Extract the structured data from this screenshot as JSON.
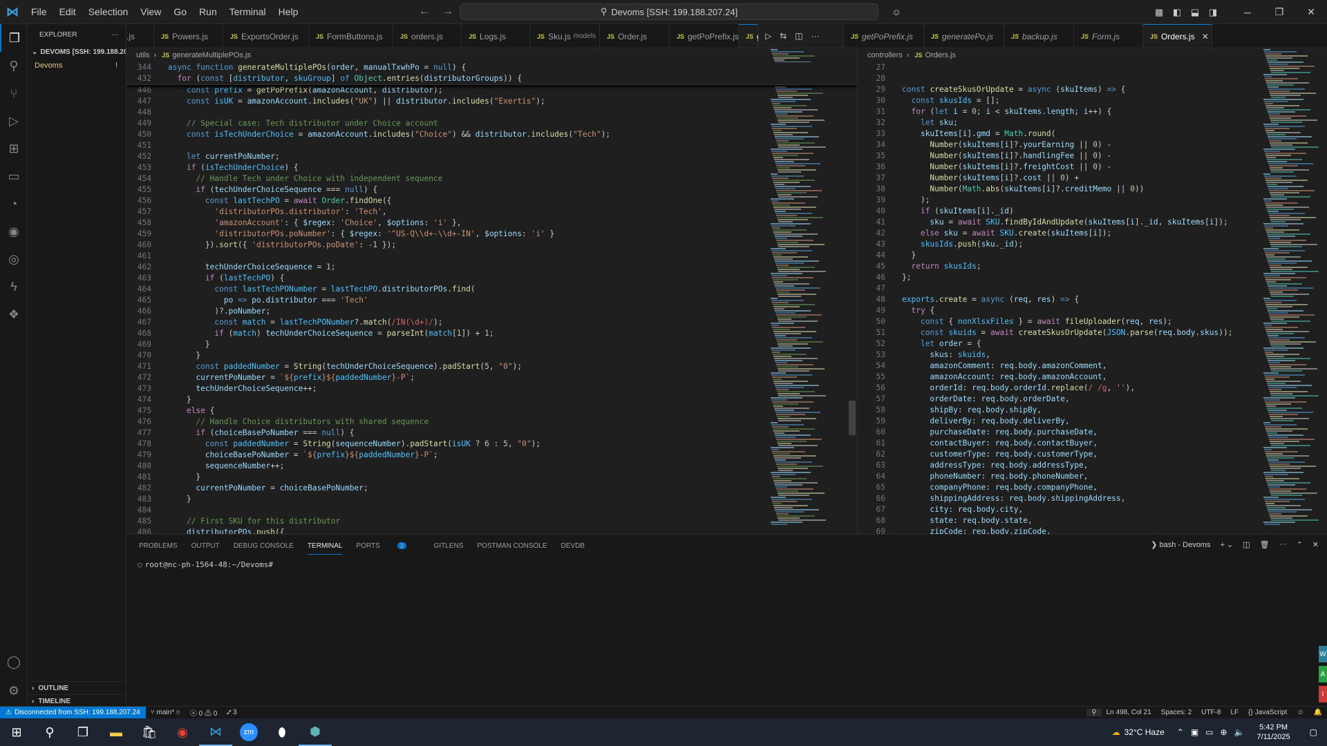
{
  "titlebar": {
    "menu": [
      "File",
      "Edit",
      "Selection",
      "View",
      "Go",
      "Run",
      "Terminal",
      "Help"
    ],
    "search_text": "Devoms [SSH: 199.188.207.24]"
  },
  "explorer": {
    "header": "EXPLORER",
    "root": "DEVOMS [SSH: 199.188.20...",
    "item": "Devoms",
    "item_badge": "!",
    "outline": "OUTLINE",
    "timeline": "TIMELINE"
  },
  "tabs": [
    {
      "label": ".js",
      "desc": ""
    },
    {
      "label": "Powers.js",
      "desc": ""
    },
    {
      "label": "ExportsOrder.js",
      "desc": ""
    },
    {
      "label": "FormButtons.js",
      "desc": ""
    },
    {
      "label": "orders.js",
      "desc": ""
    },
    {
      "label": "Logs.js",
      "desc": ""
    },
    {
      "label": "Sku.js",
      "desc": "models"
    },
    {
      "label": "Order.js",
      "desc": ""
    },
    {
      "label": "getPoPrefix.js",
      "desc": ""
    },
    {
      "label": "ge",
      "desc": ""
    }
  ],
  "tabs_right": [
    {
      "label": "getPoPrefix.js"
    },
    {
      "label": "generatePo.js"
    },
    {
      "label": "backup.js"
    },
    {
      "label": "Form.js"
    },
    {
      "label": "Orders.js"
    }
  ],
  "left_editor": {
    "breadcrumb": [
      "utils",
      "generateMultiplePOs.js"
    ],
    "sticky": [
      {
        "n": "344",
        "h": "<span class='k'>async</span> <span class='k'>function</span> <span class='f'>generateMultiplePOs</span>(<span class='v'>order</span>, <span class='v'>manualTxwhPo</span> = <span class='k'>null</span>) {"
      },
      {
        "n": "432",
        "h": "  <span class='c'>for</span> (<span class='k'>const</span> [<span class='cn'>distributor</span>, <span class='cn'>skuGroup</span>] <span class='k'>of</span> <span class='t'>Object</span>.<span class='f'>entries</span>(<span class='v'>distributorGroups</span>)) {"
      }
    ],
    "lines": [
      {
        "n": "446",
        "h": "    <span class='k'>const</span> <span class='cn'>prefix</span> = <span class='f'>getPoPrefix</span>(<span class='v'>amazonAccount</span>, <span class='v'>distributor</span>);"
      },
      {
        "n": "447",
        "h": "    <span class='k'>const</span> <span class='cn'>isUK</span> = <span class='v'>amazonAccount</span>.<span class='f'>includes</span>(<span class='s'>\"UK\"</span>) || <span class='v'>distributor</span>.<span class='f'>includes</span>(<span class='s'>\"Exertis\"</span>);"
      },
      {
        "n": "448",
        "h": ""
      },
      {
        "n": "449",
        "h": "    <span class='cm'>// Special case: Tech distributor under Choice account</span>"
      },
      {
        "n": "450",
        "h": "    <span class='k'>const</span> <span class='cn'>isTechUnderChoice</span> = <span class='v'>amazonAccount</span>.<span class='f'>includes</span>(<span class='s'>\"Choice\"</span>) &amp;&amp; <span class='v'>distributor</span>.<span class='f'>includes</span>(<span class='s'>\"Tech\"</span>);"
      },
      {
        "n": "451",
        "h": ""
      },
      {
        "n": "452",
        "h": "    <span class='k'>let</span> <span class='v'>currentPoNumber</span>;"
      },
      {
        "n": "453",
        "h": "    <span class='c'>if</span> (<span class='cn'>isTechUnderChoice</span>) {"
      },
      {
        "n": "454",
        "h": "      <span class='cm'>// Handle Tech under Choice with independent sequence</span>"
      },
      {
        "n": "455",
        "h": "      <span class='c'>if</span> (<span class='v'>techUnderChoiceSequence</span> === <span class='k'>null</span>) {"
      },
      {
        "n": "456",
        "h": "        <span class='k'>const</span> <span class='cn'>lastTechPO</span> = <span class='c'>await</span> <span class='t'>Order</span>.<span class='f'>findOne</span>({"
      },
      {
        "n": "457",
        "h": "          <span class='s'>'distributorPOs.distributor'</span>: <span class='s'>'Tech'</span>,"
      },
      {
        "n": "458",
        "h": "          <span class='s'>'amazonAccount'</span>: { <span class='v'>$regex</span>: <span class='s'>'Choice'</span>, <span class='v'>$options</span>: <span class='s'>'i'</span> },"
      },
      {
        "n": "459",
        "h": "          <span class='s'>'distributorPOs.poNumber'</span>: { <span class='v'>$regex</span>: <span class='s'>'^US-Q\\\\d+-\\\\d+-IN'</span>, <span class='v'>$options</span>: <span class='s'>'i'</span> }"
      },
      {
        "n": "460",
        "h": "        }).<span class='f'>sort</span>({ <span class='s'>'distributorPOs.poDate'</span>: <span class='n'>-1</span> });"
      },
      {
        "n": "461",
        "h": ""
      },
      {
        "n": "462",
        "h": "        <span class='v'>techUnderChoiceSequence</span> = <span class='n'>1</span>;"
      },
      {
        "n": "463",
        "h": "        <span class='c'>if</span> (<span class='cn'>lastTechPO</span>) {"
      },
      {
        "n": "464",
        "h": "          <span class='k'>const</span> <span class='cn'>lastTechPONumber</span> = <span class='cn'>lastTechPO</span>.<span class='v'>distributorPOs</span>.<span class='f'>find</span>("
      },
      {
        "n": "465",
        "h": "            <span class='v'>po</span> <span class='k'>=&gt;</span> <span class='v'>po</span>.<span class='v'>distributor</span> === <span class='s'>'Tech'</span>"
      },
      {
        "n": "466",
        "h": "          )?.<span class='v'>poNumber</span>;"
      },
      {
        "n": "467",
        "h": "          <span class='k'>const</span> <span class='cn'>match</span> = <span class='cn'>lastTechPONumber</span>?.<span class='f'>match</span>(<span class='r'>/IN(\\d+)/</span>);"
      },
      {
        "n": "468",
        "h": "          <span class='c'>if</span> (<span class='cn'>match</span>) <span class='v'>techUnderChoiceSequence</span> = <span class='f'>parseInt</span>(<span class='cn'>match</span>[<span class='n'>1</span>]) + <span class='n'>1</span>;"
      },
      {
        "n": "469",
        "h": "        }"
      },
      {
        "n": "470",
        "h": "      }"
      },
      {
        "n": "471",
        "h": "      <span class='k'>const</span> <span class='cn'>paddedNumber</span> = <span class='f'>String</span>(<span class='v'>techUnderChoiceSequence</span>).<span class='f'>padStart</span>(<span class='n'>5</span>, <span class='s'>\"0\"</span>);"
      },
      {
        "n": "472",
        "h": "      <span class='v'>currentPoNumber</span> = <span class='s'>`${</span><span class='cn'>prefix</span><span class='s'>}${</span><span class='cn'>paddedNumber</span><span class='s'>}-P`</span>;"
      },
      {
        "n": "473",
        "h": "      <span class='v'>techUnderChoiceSequence</span>++;"
      },
      {
        "n": "474",
        "h": "    }"
      },
      {
        "n": "475",
        "h": "    <span class='c'>else</span> {"
      },
      {
        "n": "476",
        "h": "      <span class='cm'>// Handle Choice distributors with shared sequence</span>"
      },
      {
        "n": "477",
        "h": "      <span class='c'>if</span> (<span class='v'>choiceBasePoNumber</span> === <span class='k'>null</span>) {"
      },
      {
        "n": "478",
        "h": "        <span class='k'>const</span> <span class='cn'>paddedNumber</span> = <span class='f'>String</span>(<span class='v'>sequenceNumber</span>).<span class='f'>padStart</span>(<span class='cn'>isUK</span> ? <span class='n'>6</span> : <span class='n'>5</span>, <span class='s'>\"0\"</span>);"
      },
      {
        "n": "479",
        "h": "        <span class='v'>choiceBasePoNumber</span> = <span class='s'>`${</span><span class='cn'>prefix</span><span class='s'>}${</span><span class='cn'>paddedNumber</span><span class='s'>}-P`</span>;"
      },
      {
        "n": "480",
        "h": "        <span class='v'>sequenceNumber</span>++;"
      },
      {
        "n": "481",
        "h": "      }"
      },
      {
        "n": "482",
        "h": "      <span class='v'>currentPoNumber</span> = <span class='v'>choiceBasePoNumber</span>;"
      },
      {
        "n": "483",
        "h": "    }"
      },
      {
        "n": "484",
        "h": ""
      },
      {
        "n": "485",
        "h": "    <span class='cm'>// First SKU for this distributor</span>"
      },
      {
        "n": "486",
        "h": "    <span class='v'>distributorPOs</span>.<span class='f'>push</span>({"
      }
    ]
  },
  "right_editor": {
    "breadcrumb": [
      "controllers",
      "Orders.js"
    ],
    "lines": [
      {
        "n": "27",
        "h": ""
      },
      {
        "n": "28",
        "h": ""
      },
      {
        "n": "29",
        "h": "<span class='k'>const</span> <span class='f'>createSkusOrUpdate</span> = <span class='k'>async</span> (<span class='v'>skuItems</span>) <span class='k'>=&gt;</span> {"
      },
      {
        "n": "30",
        "h": "  <span class='k'>const</span> <span class='cn'>skusIds</span> = [];"
      },
      {
        "n": "31",
        "h": "  <span class='c'>for</span> (<span class='k'>let</span> <span class='v'>i</span> = <span class='n'>0</span>; <span class='v'>i</span> &lt; <span class='v'>skuItems</span>.<span class='v'>length</span>; <span class='v'>i</span>++) {"
      },
      {
        "n": "32",
        "h": "    <span class='k'>let</span> <span class='v'>sku</span>;"
      },
      {
        "n": "33",
        "h": "    <span class='v'>skuItems</span>[<span class='v'>i</span>].<span class='v'>gmd</span> = <span class='t'>Math</span>.<span class='f'>round</span>("
      },
      {
        "n": "34",
        "h": "      <span class='f'>Number</span>(<span class='v'>skuItems</span>[<span class='v'>i</span>]?.<span class='v'>yourEarning</span> || <span class='n'>0</span>) -"
      },
      {
        "n": "35",
        "h": "      <span class='f'>Number</span>(<span class='v'>skuItems</span>[<span class='v'>i</span>]?.<span class='v'>handlingFee</span> || <span class='n'>0</span>) -"
      },
      {
        "n": "36",
        "h": "      <span class='f'>Number</span>(<span class='v'>skuItems</span>[<span class='v'>i</span>]?.<span class='v'>freightCost</span> || <span class='n'>0</span>) -"
      },
      {
        "n": "37",
        "h": "      <span class='f'>Number</span>(<span class='v'>skuItems</span>[<span class='v'>i</span>]?.<span class='v'>cost</span> || <span class='n'>0</span>) +"
      },
      {
        "n": "38",
        "h": "      <span class='f'>Number</span>(<span class='t'>Math</span>.<span class='f'>abs</span>(<span class='v'>skuItems</span>[<span class='v'>i</span>]?.<span class='v'>creditMemo</span> || <span class='n'>0</span>))"
      },
      {
        "n": "39",
        "h": "    );"
      },
      {
        "n": "40",
        "h": "    <span class='c'>if</span> (<span class='v'>skuItems</span>[<span class='v'>i</span>].<span class='v'>_id</span>)"
      },
      {
        "n": "41",
        "h": "      <span class='v'>sku</span> = <span class='c'>await</span> <span class='cn'>SKU</span>.<span class='f'>findByIdAndUpdate</span>(<span class='v'>skuItems</span>[<span class='v'>i</span>].<span class='v'>_id</span>, <span class='v'>skuItems</span>[<span class='v'>i</span>]);"
      },
      {
        "n": "42",
        "h": "    <span class='c'>else</span> <span class='v'>sku</span> = <span class='c'>await</span> <span class='cn'>SKU</span>.<span class='f'>create</span>(<span class='v'>skuItems</span>[<span class='v'>i</span>]);"
      },
      {
        "n": "43",
        "h": "    <span class='cn'>skusIds</span>.<span class='f'>push</span>(<span class='v'>sku</span>.<span class='v'>_id</span>);"
      },
      {
        "n": "44",
        "h": "  }"
      },
      {
        "n": "45",
        "h": "  <span class='c'>return</span> <span class='cn'>skusIds</span>;"
      },
      {
        "n": "46",
        "h": "};"
      },
      {
        "n": "47",
        "h": ""
      },
      {
        "n": "48",
        "h": "<span class='cn'>exports</span>.<span class='f'>create</span> = <span class='k'>async</span> (<span class='v'>req</span>, <span class='v'>res</span>) <span class='k'>=&gt;</span> {"
      },
      {
        "n": "49",
        "h": "  <span class='c'>try</span> {"
      },
      {
        "n": "50",
        "h": "    <span class='k'>const</span> { <span class='cn'>nonXlsxFiles</span> } = <span class='c'>await</span> <span class='f'>fileUploader</span>(<span class='v'>req</span>, <span class='v'>res</span>);"
      },
      {
        "n": "51",
        "h": "    <span class='k'>const</span> <span class='cn'>skuids</span> = <span class='c'>await</span> <span class='f'>createSkusOrUpdate</span>(<span class='cn'>JSON</span>.<span class='f'>parse</span>(<span class='v'>req</span>.<span class='v'>body</span>.<span class='v'>skus</span>));"
      },
      {
        "n": "52",
        "h": "    <span class='k'>let</span> <span class='v'>order</span> = {"
      },
      {
        "n": "53",
        "h": "      <span class='v'>skus</span>: <span class='cn'>skuids</span>,"
      },
      {
        "n": "54",
        "h": "      <span class='v'>amazonComment</span>: <span class='v'>req</span>.<span class='v'>body</span>.<span class='v'>amazonComment</span>,"
      },
      {
        "n": "55",
        "h": "      <span class='v'>amazonAccount</span>: <span class='v'>req</span>.<span class='v'>body</span>.<span class='v'>amazonAccount</span>,"
      },
      {
        "n": "56",
        "h": "      <span class='v'>orderId</span>: <span class='v'>req</span>.<span class='v'>body</span>.<span class='v'>orderId</span>.<span class='f'>replace</span>(<span class='r'>/ /g</span>, <span class='s'>''</span>),"
      },
      {
        "n": "57",
        "h": "      <span class='v'>orderDate</span>: <span class='v'>req</span>.<span class='v'>body</span>.<span class='v'>orderDate</span>,"
      },
      {
        "n": "58",
        "h": "      <span class='v'>shipBy</span>: <span class='v'>req</span>.<span class='v'>body</span>.<span class='v'>shipBy</span>,"
      },
      {
        "n": "59",
        "h": "      <span class='v'>deliverBy</span>: <span class='v'>req</span>.<span class='v'>body</span>.<span class='v'>deliverBy</span>,"
      },
      {
        "n": "60",
        "h": "      <span class='v'>purchaseDate</span>: <span class='v'>req</span>.<span class='v'>body</span>.<span class='v'>purchaseDate</span>,"
      },
      {
        "n": "61",
        "h": "      <span class='v'>contactBuyer</span>: <span class='v'>req</span>.<span class='v'>body</span>.<span class='v'>contactBuyer</span>,"
      },
      {
        "n": "62",
        "h": "      <span class='v'>customerType</span>: <span class='v'>req</span>.<span class='v'>body</span>.<span class='v'>customerType</span>,"
      },
      {
        "n": "63",
        "h": "      <span class='v'>addressType</span>: <span class='v'>req</span>.<span class='v'>body</span>.<span class='v'>addressType</span>,"
      },
      {
        "n": "64",
        "h": "      <span class='v'>phoneNumber</span>: <span class='v'>req</span>.<span class='v'>body</span>.<span class='v'>phoneNumber</span>,"
      },
      {
        "n": "65",
        "h": "      <span class='v'>companyPhone</span>: <span class='v'>req</span>.<span class='v'>body</span>.<span class='v'>companyPhone</span>,"
      },
      {
        "n": "66",
        "h": "      <span class='v'>shippingAddress</span>: <span class='v'>req</span>.<span class='v'>body</span>.<span class='v'>shippingAddress</span>,"
      },
      {
        "n": "67",
        "h": "      <span class='v'>city</span>: <span class='v'>req</span>.<span class='v'>body</span>.<span class='v'>city</span>,"
      },
      {
        "n": "68",
        "h": "      <span class='v'>state</span>: <span class='v'>req</span>.<span class='v'>body</span>.<span class='v'>state</span>,"
      },
      {
        "n": "69",
        "h": "      <span class='v'>zipCode</span>: <span class='v'>req</span>.<span class='v'>body</span>.<span class='v'>zipCode</span>,"
      }
    ]
  },
  "panel": {
    "tabs": [
      "PROBLEMS",
      "OUTPUT",
      "DEBUG CONSOLE",
      "TERMINAL",
      "PORTS",
      "GITLENS",
      "POSTMAN CONSOLE",
      "DEVDB"
    ],
    "active_tab": "TERMINAL",
    "ports_badge": "3",
    "terminal_name": "bash - Devoms",
    "prompt": "root@nc-ph-1564-48:~/Devoms#"
  },
  "statusbar": {
    "remote": "Disconnected from SSH: 199.188.207.24",
    "branch": "main*",
    "errors": "0",
    "warnings": "0",
    "ports": "3",
    "position": "Ln 498, Col 21",
    "spaces": "Spaces: 2",
    "encoding": "UTF-8",
    "eol": "LF",
    "language": "JavaScript"
  },
  "taskbar": {
    "weather": "32°C  Haze",
    "time": "5:42 PM",
    "date": "7/11/2025"
  }
}
